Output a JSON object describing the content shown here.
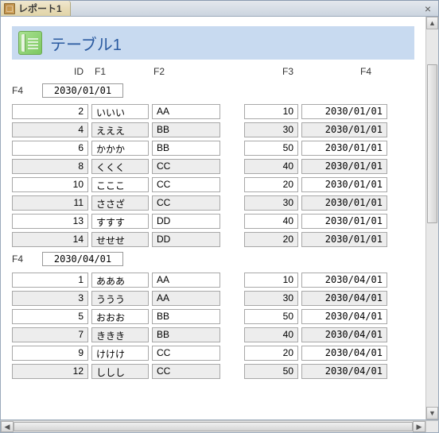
{
  "tab": {
    "title": "レポート1"
  },
  "report": {
    "title": "テーブル1"
  },
  "columns": {
    "id": "ID",
    "f1": "F1",
    "f2": "F2",
    "f3": "F3",
    "f4": "F4"
  },
  "groups": [
    {
      "label": "F4",
      "value": "2030/01/01",
      "rows": [
        {
          "id": "2",
          "f1": "いいい",
          "f2": "AA",
          "f3": "10",
          "f4": "2030/01/01",
          "alt": false
        },
        {
          "id": "4",
          "f1": "えええ",
          "f2": "BB",
          "f3": "30",
          "f4": "2030/01/01",
          "alt": true
        },
        {
          "id": "6",
          "f1": "かかか",
          "f2": "BB",
          "f3": "50",
          "f4": "2030/01/01",
          "alt": false
        },
        {
          "id": "8",
          "f1": "くくく",
          "f2": "CC",
          "f3": "40",
          "f4": "2030/01/01",
          "alt": true
        },
        {
          "id": "10",
          "f1": "こここ",
          "f2": "CC",
          "f3": "20",
          "f4": "2030/01/01",
          "alt": false
        },
        {
          "id": "11",
          "f1": "ささざ",
          "f2": "CC",
          "f3": "30",
          "f4": "2030/01/01",
          "alt": true
        },
        {
          "id": "13",
          "f1": "すすす",
          "f2": "DD",
          "f3": "40",
          "f4": "2030/01/01",
          "alt": false
        },
        {
          "id": "14",
          "f1": "せせせ",
          "f2": "DD",
          "f3": "20",
          "f4": "2030/01/01",
          "alt": true
        }
      ]
    },
    {
      "label": "F4",
      "value": "2030/04/01",
      "rows": [
        {
          "id": "1",
          "f1": "あああ",
          "f2": "AA",
          "f3": "10",
          "f4": "2030/04/01",
          "alt": false
        },
        {
          "id": "3",
          "f1": "ううう",
          "f2": "AA",
          "f3": "30",
          "f4": "2030/04/01",
          "alt": true
        },
        {
          "id": "5",
          "f1": "おおお",
          "f2": "BB",
          "f3": "50",
          "f4": "2030/04/01",
          "alt": false
        },
        {
          "id": "7",
          "f1": "ききき",
          "f2": "BB",
          "f3": "40",
          "f4": "2030/04/01",
          "alt": true
        },
        {
          "id": "9",
          "f1": "けけけ",
          "f2": "CC",
          "f3": "20",
          "f4": "2030/04/01",
          "alt": false
        },
        {
          "id": "12",
          "f1": "ししし",
          "f2": "CC",
          "f3": "50",
          "f4": "2030/04/01",
          "alt": true
        }
      ]
    }
  ]
}
